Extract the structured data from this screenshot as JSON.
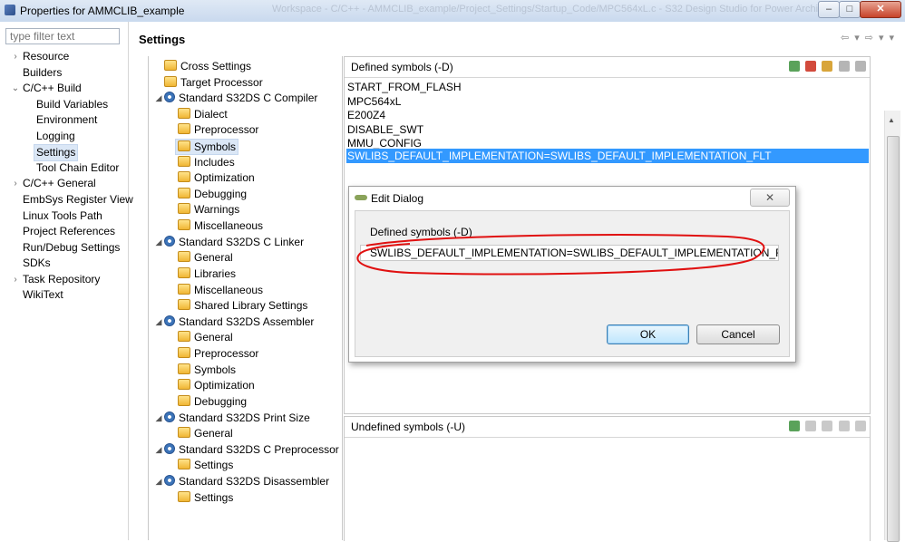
{
  "window": {
    "title": "Properties for AMMCLIB_example",
    "ghost_title": "Workspace - C/C++ - AMMCLIB_example/Project_Settings/Startup_Code/MPC564xL.c - S32 Design Studio for Power Architecture",
    "min_glyph": "–",
    "max_glyph": "□",
    "close_glyph": "✕"
  },
  "leftnav": {
    "filter_placeholder": "type filter text",
    "items": [
      {
        "label": "Resource"
      },
      {
        "label": "Builders"
      },
      {
        "label": "C/C++ Build"
      },
      {
        "label": "Build Variables"
      },
      {
        "label": "Environment"
      },
      {
        "label": "Logging"
      },
      {
        "label": "Settings"
      },
      {
        "label": "Tool Chain Editor"
      },
      {
        "label": "C/C++ General"
      },
      {
        "label": "EmbSys Register View"
      },
      {
        "label": "Linux Tools Path"
      },
      {
        "label": "Project References"
      },
      {
        "label": "Run/Debug Settings"
      },
      {
        "label": "SDKs"
      },
      {
        "label": "Task Repository"
      },
      {
        "label": "WikiText"
      }
    ]
  },
  "header": {
    "title": "Settings",
    "icons": [
      "back-icon",
      "dropdown-icon",
      "forward-icon",
      "dropdown-icon",
      "menu-icon"
    ]
  },
  "tree": {
    "items": [
      {
        "label": "Cross Settings"
      },
      {
        "label": "Target Processor"
      },
      {
        "label": "Standard S32DS C Compiler"
      },
      {
        "label": "Dialect"
      },
      {
        "label": "Preprocessor"
      },
      {
        "label": "Symbols"
      },
      {
        "label": "Includes"
      },
      {
        "label": "Optimization"
      },
      {
        "label": "Debugging"
      },
      {
        "label": "Warnings"
      },
      {
        "label": "Miscellaneous"
      },
      {
        "label": "Standard S32DS C Linker"
      },
      {
        "label": "General"
      },
      {
        "label": "Libraries"
      },
      {
        "label": "Miscellaneous"
      },
      {
        "label": "Shared Library Settings"
      },
      {
        "label": "Standard S32DS Assembler"
      },
      {
        "label": "General"
      },
      {
        "label": "Preprocessor"
      },
      {
        "label": "Symbols"
      },
      {
        "label": "Optimization"
      },
      {
        "label": "Debugging"
      },
      {
        "label": "Standard S32DS Print Size"
      },
      {
        "label": "General"
      },
      {
        "label": "Standard S32DS C Preprocessor"
      },
      {
        "label": "Settings"
      },
      {
        "label": "Standard S32DS Disassembler"
      },
      {
        "label": "Settings"
      }
    ]
  },
  "defined": {
    "label": "Defined symbols (-D)",
    "symbols": [
      "START_FROM_FLASH",
      "MPC564xL",
      "E200Z4",
      "DISABLE_SWT",
      "MMU_CONFIG",
      "SWLIBS_DEFAULT_IMPLEMENTATION=SWLIBS_DEFAULT_IMPLEMENTATION_FLT"
    ]
  },
  "undefined": {
    "label": "Undefined symbols (-U)"
  },
  "dialog": {
    "title": "Edit Dialog",
    "close_glyph": "✕",
    "field_label": "Defined symbols (-D)",
    "field_value": "SWLIBS_DEFAULT_IMPLEMENTATION=SWLIBS_DEFAULT_IMPLEMENTATION_FLT",
    "ok_label": "OK",
    "cancel_label": "Cancel",
    "annotation_color": "#e01010"
  },
  "colors": {
    "selection": "#3399ff",
    "tree_selection": "#dbe7f6"
  }
}
